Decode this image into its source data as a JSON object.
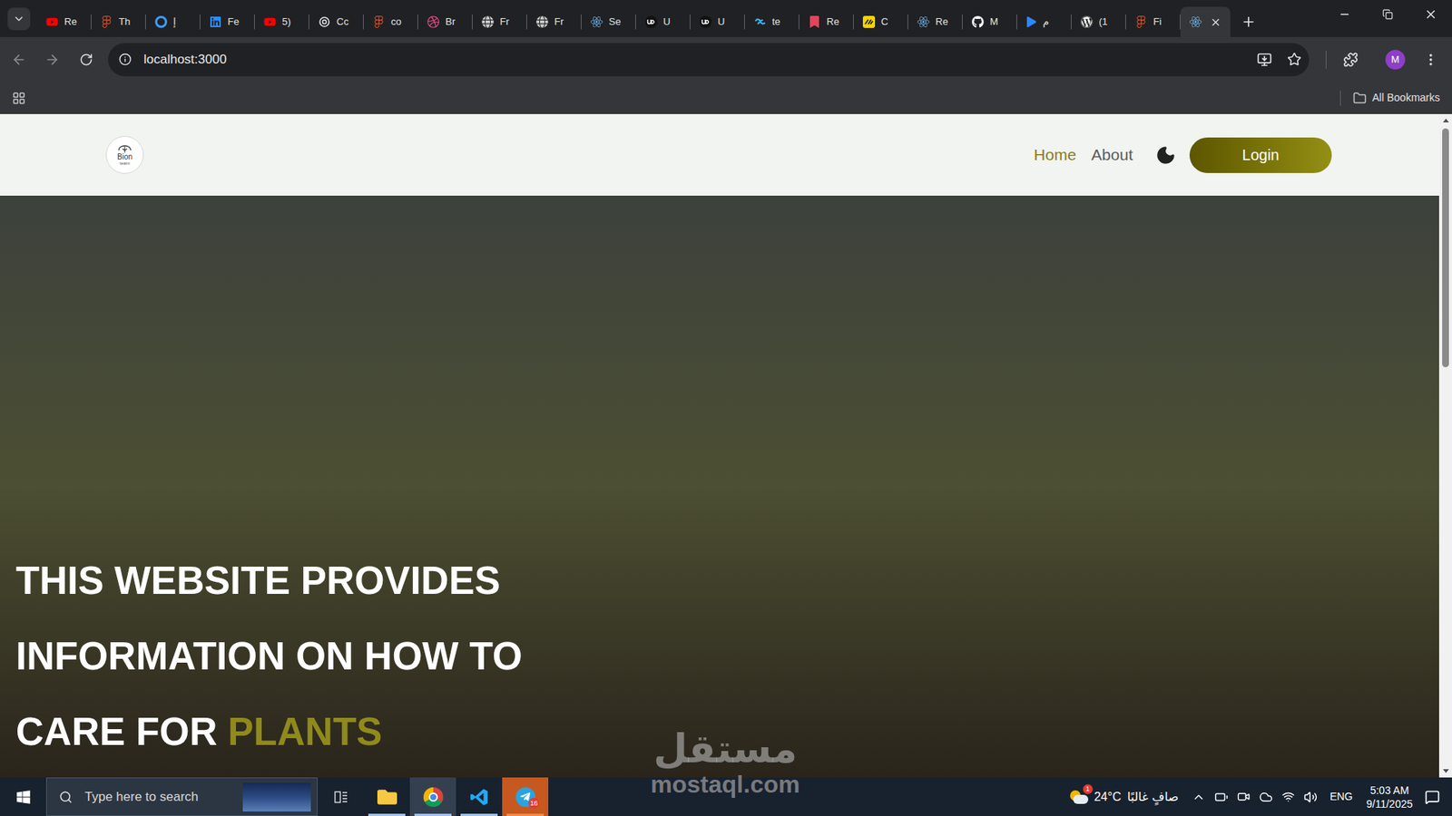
{
  "browser": {
    "tabs": [
      {
        "kind": "youtube",
        "label": "Re",
        "selected": false
      },
      {
        "kind": "figma",
        "label": "Th",
        "selected": false
      },
      {
        "kind": "ring",
        "label": "إ",
        "selected": false
      },
      {
        "kind": "linkedin",
        "label": "Fe",
        "selected": false
      },
      {
        "kind": "youtube",
        "label": "5)",
        "selected": false
      },
      {
        "kind": "openai",
        "label": "Cc",
        "selected": false
      },
      {
        "kind": "figma",
        "label": "co",
        "selected": false
      },
      {
        "kind": "dribbble",
        "label": "Br",
        "selected": false
      },
      {
        "kind": "globe",
        "label": "Fr",
        "selected": false
      },
      {
        "kind": "globe",
        "label": "Fr",
        "selected": false
      },
      {
        "kind": "react",
        "label": "Se",
        "selected": false
      },
      {
        "kind": "upwork",
        "label": "U",
        "selected": false
      },
      {
        "kind": "upwork",
        "label": "U",
        "selected": false
      },
      {
        "kind": "tailwind",
        "label": "te",
        "selected": false
      },
      {
        "kind": "bookmark",
        "label": "Re",
        "selected": false
      },
      {
        "kind": "yellow",
        "label": "C",
        "selected": false
      },
      {
        "kind": "react",
        "label": "Re",
        "selected": false
      },
      {
        "kind": "github",
        "label": "M",
        "selected": false
      },
      {
        "kind": "play",
        "label": "م",
        "selected": false
      },
      {
        "kind": "wordpress",
        "label": "(1",
        "selected": false
      },
      {
        "kind": "figma",
        "label": "Fi",
        "selected": false
      },
      {
        "kind": "react",
        "selected": true
      }
    ],
    "address": "localhost:3000",
    "bookmarks": "All Bookmarks",
    "profile": "M"
  },
  "page": {
    "logo": {
      "title": "Bion",
      "subtitle": "team"
    },
    "nav": [
      {
        "label": "Home",
        "selected": true
      },
      {
        "label": "About",
        "selected": false
      }
    ],
    "login": "Login",
    "hero": {
      "lines": [
        "THIS WEBSITE PROVIDES",
        "INFORMATION ON HOW TO"
      ],
      "last_line": "CARE FOR",
      "highlight": "PLANTS"
    }
  },
  "watermark": {
    "logo": "مستقل",
    "url": "mostaql.com"
  },
  "taskbar": {
    "search_placeholder": "Type here to search",
    "apps": [
      {
        "kind": "explorer",
        "open": true,
        "selected": false
      },
      {
        "kind": "chrome",
        "open": true,
        "selected": true
      },
      {
        "kind": "vscode",
        "open": true,
        "selected": false
      },
      {
        "kind": "telegram",
        "open": true,
        "selected": false,
        "attention": true,
        "badge": "16"
      }
    ],
    "weather": {
      "badge": "1",
      "temp": "24°C",
      "condition": "صافٍ غالبًا"
    },
    "language": "ENG",
    "time": "5:03 AM",
    "date": "9/11/2025"
  }
}
